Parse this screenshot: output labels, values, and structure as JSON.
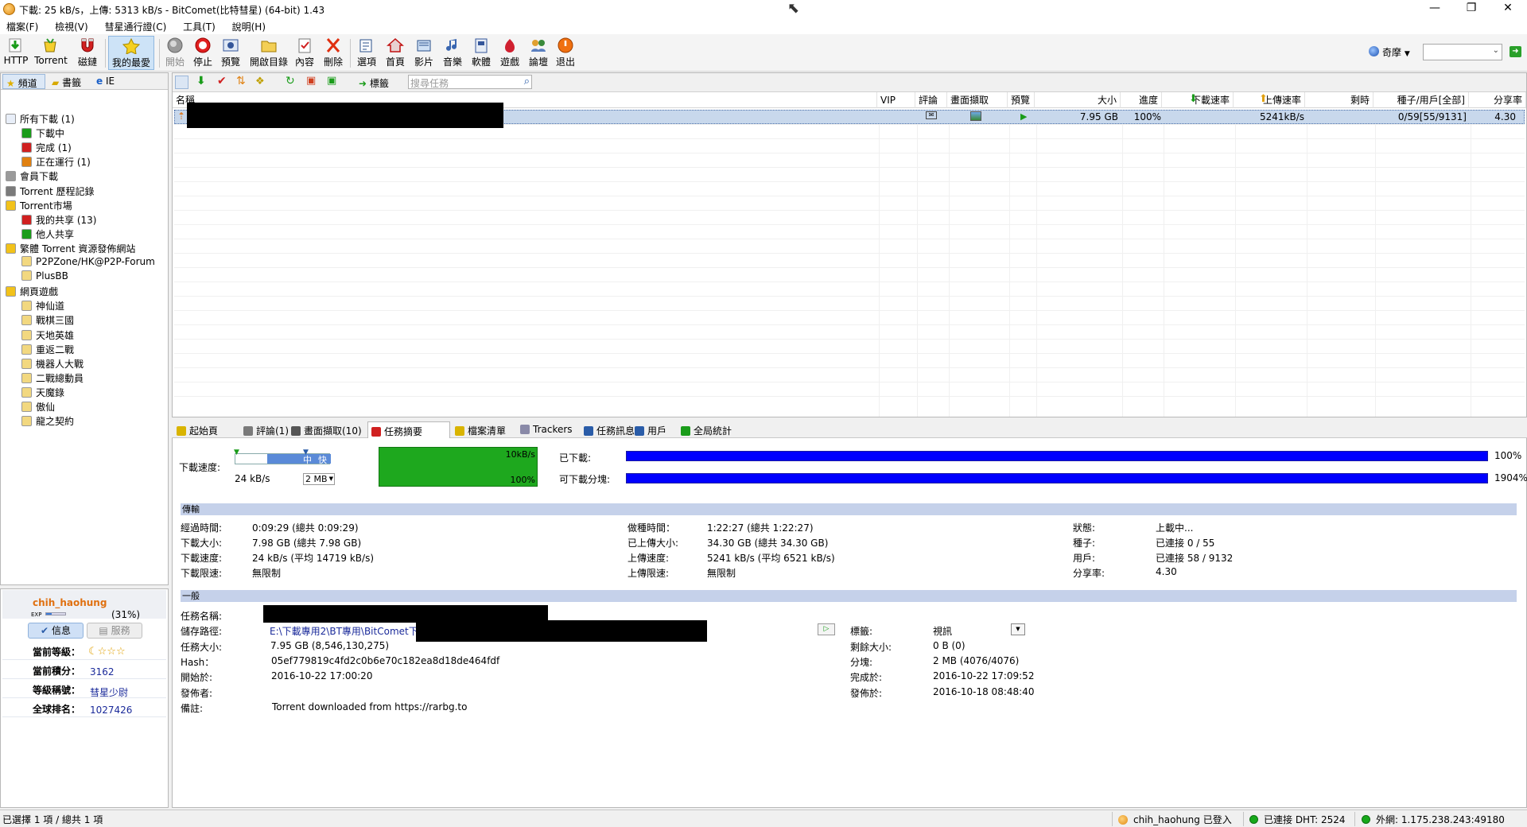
{
  "window": {
    "title": "下載: 25 kB/s，上傳: 5313 kB/s - BitComet(比特彗星) (64-bit) 1.43",
    "minimize": "—",
    "restore": "❐",
    "close": "✕"
  },
  "menu": [
    "檔案(F)",
    "檢視(V)",
    "彗星通行證(C)",
    "工具(T)",
    "說明(H)"
  ],
  "toolbar": {
    "buttons": [
      {
        "label": "HTTP",
        "icon": "http-download-icon"
      },
      {
        "label": "Torrent",
        "icon": "torrent-icon"
      },
      {
        "label": "磁鏈",
        "icon": "magnet-icon"
      },
      {
        "label": "我的最愛",
        "icon": "favorite-star-icon"
      },
      {
        "label": "開始",
        "icon": "start-icon"
      },
      {
        "label": "停止",
        "icon": "stop-icon"
      },
      {
        "label": "預覽",
        "icon": "preview-icon"
      },
      {
        "label": "開啟目錄",
        "icon": "open-folder-icon"
      },
      {
        "label": "內容",
        "icon": "properties-icon"
      },
      {
        "label": "刪除",
        "icon": "delete-icon"
      },
      {
        "label": "選項",
        "icon": "options-icon"
      },
      {
        "label": "首頁",
        "icon": "home-icon"
      },
      {
        "label": "影片",
        "icon": "video-icon"
      },
      {
        "label": "音樂",
        "icon": "music-icon"
      },
      {
        "label": "軟體",
        "icon": "software-icon"
      },
      {
        "label": "遊戲",
        "icon": "game-icon"
      },
      {
        "label": "論壇",
        "icon": "forum-icon"
      },
      {
        "label": "退出",
        "icon": "exit-icon"
      }
    ],
    "search_engine": "奇摩",
    "search_value": ""
  },
  "left": {
    "tabs": [
      "頻道",
      "書籤",
      "IE"
    ],
    "tree": [
      {
        "label": "所有下載 (1)",
        "indent": 0
      },
      {
        "label": "下載中",
        "indent": 1
      },
      {
        "label": "完成 (1)",
        "indent": 1
      },
      {
        "label": "正在運行 (1)",
        "indent": 1
      },
      {
        "label": "會員下載",
        "indent": 0
      },
      {
        "label": "Torrent 歷程記錄",
        "indent": 0
      },
      {
        "label": "Torrent市場",
        "indent": 0
      },
      {
        "label": "我的共享 (13)",
        "indent": 1
      },
      {
        "label": "他人共享",
        "indent": 1
      },
      {
        "label": "繁體 Torrent 資源發佈網站",
        "indent": 0
      },
      {
        "label": "P2PZone/HK@P2P-Forum",
        "indent": 1
      },
      {
        "label": "PlusBB",
        "indent": 1
      },
      {
        "label": "網頁遊戲",
        "indent": 0
      },
      {
        "label": "神仙道",
        "indent": 1
      },
      {
        "label": "戰棋三國",
        "indent": 1
      },
      {
        "label": "天地英雄",
        "indent": 1
      },
      {
        "label": "重返二戰",
        "indent": 1
      },
      {
        "label": "機器人大戰",
        "indent": 1
      },
      {
        "label": "二戰總動員",
        "indent": 1
      },
      {
        "label": "天魔錄",
        "indent": 1
      },
      {
        "label": "傲仙",
        "indent": 1
      },
      {
        "label": "龍之契約",
        "indent": 1
      }
    ]
  },
  "user": {
    "name": "chih_haohung",
    "exp_label": "EXP",
    "exp_percent": "(31%)",
    "exp_fraction": 0.31,
    "tab_info": "信息",
    "tab_service": "服務",
    "rows": [
      {
        "k": "當前等級：",
        "v": ""
      },
      {
        "k": "當前積分：",
        "v": "3162"
      },
      {
        "k": "等級稱號：",
        "v": "彗星少尉"
      },
      {
        "k": "全球排名：",
        "v": "1027426"
      }
    ]
  },
  "list": {
    "toolbar_tags_label": "標籤",
    "search_placeholder": "搜尋任務",
    "columns": [
      "名稱",
      "VIP",
      "評論",
      "畫面擷取",
      "預覽",
      "大小",
      "進度",
      "下載速率",
      "上傳速率",
      "剩時",
      "種子/用戶[全部]",
      "分享率"
    ],
    "row": {
      "name": "",
      "vip": "",
      "size": "7.95 GB",
      "progress": "100%",
      "dl": "",
      "ul": "5241kB/s",
      "eta": "",
      "peers": "0/59[55/9131]",
      "ratio": "4.30"
    }
  },
  "bottom_tabs": [
    "起始頁",
    "評論(1)",
    "畫面擷取(10)",
    "任務摘要",
    "檔案清單",
    "Trackers",
    "任務訊息",
    "用戶",
    "全局統計"
  ],
  "summary": {
    "speed_label": "下載速度:",
    "speed_value": "24 kB/s",
    "slider_mid": "中",
    "slider_fast": "快",
    "block_size": "2 MB",
    "graph_top": "10kB/s",
    "graph_bottom": "100%",
    "downloaded_label": "已下載:",
    "downloaded_pct": "100%",
    "downloaded_fraction": 1.0,
    "avail_label": "可下載分塊:",
    "avail_pct": "1904%",
    "avail_fraction": 1.0
  },
  "transfer": {
    "title": "傳輸",
    "col1": [
      {
        "k": "經過時間:",
        "v": "0:09:29 (總共 0:09:29)"
      },
      {
        "k": "下載大小:",
        "v": "7.98 GB (總共 7.98 GB)"
      },
      {
        "k": "下載速度:",
        "v": "24 kB/s (平均 14719 kB/s)"
      },
      {
        "k": "下載限速:",
        "v": "無限制"
      }
    ],
    "col2": [
      {
        "k": "做種時間：",
        "v": "1:22:27 (總共 1:22:27)"
      },
      {
        "k": "已上傳大小:",
        "v": "34.30 GB (總共 34.30 GB)"
      },
      {
        "k": "上傳速度:",
        "v": "5241 kB/s (平均 6521 kB/s)"
      },
      {
        "k": "上傳限速:",
        "v": "無限制"
      }
    ],
    "col3": [
      {
        "k": "狀態:",
        "v": "上載中..."
      },
      {
        "k": "種子:",
        "v": "已連接 0 / 55"
      },
      {
        "k": "用戶:",
        "v": "已連接 58 / 9132"
      },
      {
        "k": "分享率:",
        "v": "4.30"
      }
    ]
  },
  "general": {
    "title": "一般",
    "task_name_label": "任務名稱:",
    "path_label": "儲存路徑:",
    "path_value": "E:\\下載專用2\\BT專用\\BitComet下載",
    "size_label": "任務大小:",
    "size_value": "7.95 GB (8,546,130,275)",
    "hash_label": "Hash：",
    "hash_value": "05ef779819c4fd2c0b6e70c182ea8d18de464fdf",
    "start_label": "開始於:",
    "start_value": "2016-10-22 17:00:20",
    "publisher_label": "發佈者:",
    "note_label": "備註:",
    "note_value": "Torrent downloaded from https://rarbg.to",
    "tag_label": "標籤:",
    "tag_value": "視訊",
    "remain_label": "剩餘大小:",
    "remain_value": "0 B (0)",
    "block_label": "分塊:",
    "block_value": "2 MB (4076/4076)",
    "done_label": "完成於:",
    "done_value": "2016-10-22 17:09:52",
    "pub_label": "發佈於:",
    "pub_value": "2016-10-18 08:48:40"
  },
  "status": {
    "left": "已選擇 1 項 / 總共 1 項",
    "user": "chih_haohung 已登入",
    "dht": "已連接 DHT: 2524",
    "ext": "外網: 1.175.238.243:49180"
  }
}
